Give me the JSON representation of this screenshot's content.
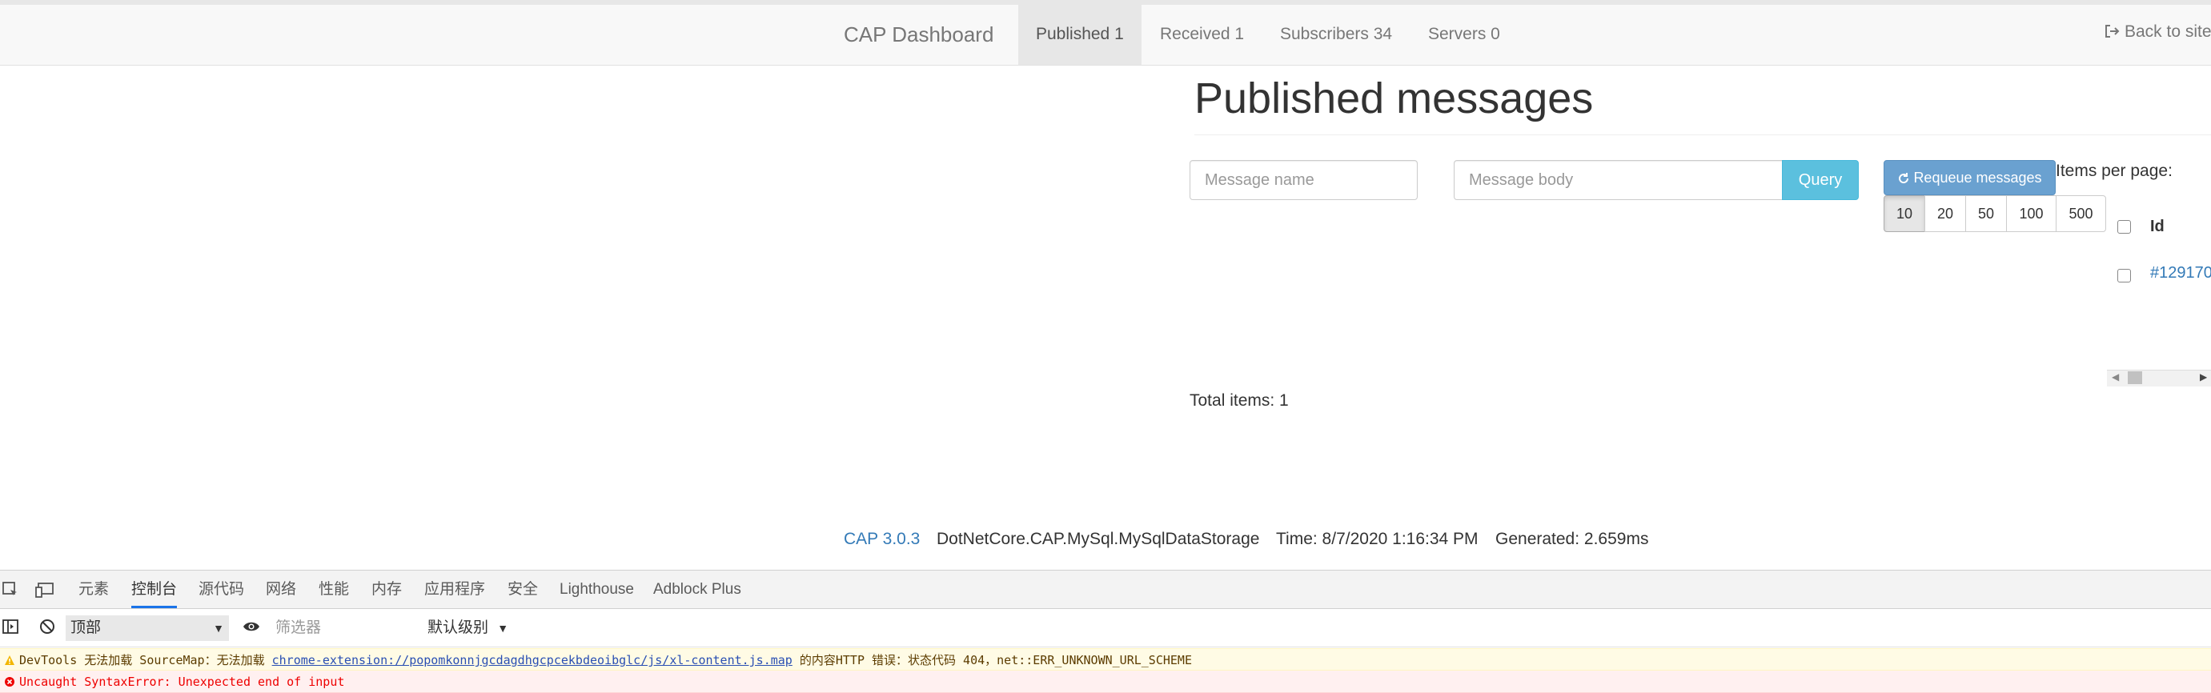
{
  "navbar": {
    "brand": "CAP Dashboard",
    "tabs": [
      {
        "label": "Published 1",
        "active": true
      },
      {
        "label": "Received 1"
      },
      {
        "label": "Subscribers 34"
      },
      {
        "label": "Servers 0"
      }
    ],
    "back_label": "Back to site"
  },
  "main": {
    "title": "Published messages",
    "name_placeholder": "Message name",
    "body_placeholder": "Message body",
    "query_label": "Query",
    "requeue_label": "Requeue messages",
    "items_per_page_label": "Items per page:",
    "page_sizes": [
      "10",
      "20",
      "50",
      "100",
      "500"
    ],
    "selected_page_size": "10",
    "table": {
      "columns": [
        "Id"
      ],
      "rows": [
        {
          "id": "#129170"
        }
      ]
    },
    "total_items": "Total items: 1"
  },
  "footer": {
    "version": "CAP 3.0.3",
    "storage": "DotNetCore.CAP.MySql.MySqlDataStorage",
    "time": "Time: 8/7/2020 1:16:34 PM",
    "generated": "Generated: 2.659ms"
  },
  "devtools": {
    "tabs": [
      "元素",
      "控制台",
      "源代码",
      "网络",
      "性能",
      "内存",
      "应用程序",
      "安全",
      "Lighthouse",
      "Adblock Plus"
    ],
    "active_tab": "控制台",
    "context": "顶部",
    "filter_placeholder": "筛选器",
    "level": "默认级别",
    "messages": [
      {
        "level": "warning",
        "prefix": "DevTools 无法加载 SourceMap：无法加载 ",
        "link": "chrome-extension://popomkonnjgcdagdhgcpcekbdeoibglc/js/xl-content.js.map",
        "suffix": " 的内容HTTP 错误：状态代码 404，net::ERR_UNKNOWN_URL_SCHEME"
      },
      {
        "level": "error",
        "text": "Uncaught SyntaxError: Unexpected end of input"
      }
    ],
    "colors": {
      "accent": "#1a73e8",
      "warning_bg": "#fffbe5",
      "error_text": "#ee0000"
    }
  },
  "colors": {
    "link": "#337ab7",
    "info_button": "#5bc0de",
    "primary_button": "#6aa1d0"
  }
}
